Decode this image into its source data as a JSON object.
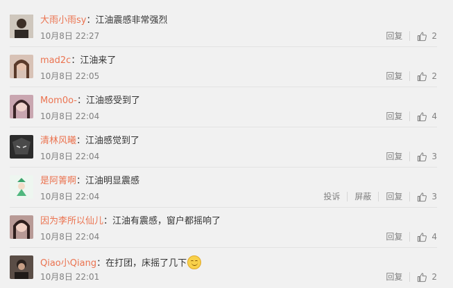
{
  "comments": [
    {
      "username": "大雨小雨sy",
      "text": "：江油震感非常强烈",
      "time": "10月8日 22:27",
      "reply": "回复",
      "likes": "2",
      "avatar_color": "#6b5d52",
      "emoji": false
    },
    {
      "username": "mad2c",
      "text": "：江油来了",
      "time": "10月8日 22:05",
      "reply": "回复",
      "likes": "2",
      "avatar_color": "#a77c6b",
      "emoji": false
    },
    {
      "username": "Mom0o-",
      "text": "：江油感受到了",
      "time": "10月8日 22:04",
      "reply": "回复",
      "likes": "4",
      "avatar_color": "#8a5a60",
      "emoji": false
    },
    {
      "username": "清林风曦",
      "text": "：江油感觉到了",
      "time": "10月8日 22:04",
      "reply": "回复",
      "likes": "3",
      "avatar_color": "#3a3a3a",
      "emoji": false
    },
    {
      "username": "是阿箐啊",
      "text": "：江油明显震感",
      "time": "10月8日 22:04",
      "reply": "回复",
      "likes": "3",
      "avatar_color": "#d9efe3",
      "report": "投诉",
      "block": "屏蔽",
      "emoji": false
    },
    {
      "username": "因为李所以仙儿",
      "text": "：江油有震感，窗户都摇响了",
      "time": "10月8日 22:04",
      "reply": "回复",
      "likes": "4",
      "avatar_color": "#6e4a4c",
      "emoji": false
    },
    {
      "username": "Qiao小Qiang",
      "text": "：在打团，床摇了几下",
      "time": "10月8日 22:01",
      "reply": "回复",
      "likes": "2",
      "avatar_color": "#4a3f3a",
      "emoji": true
    }
  ]
}
